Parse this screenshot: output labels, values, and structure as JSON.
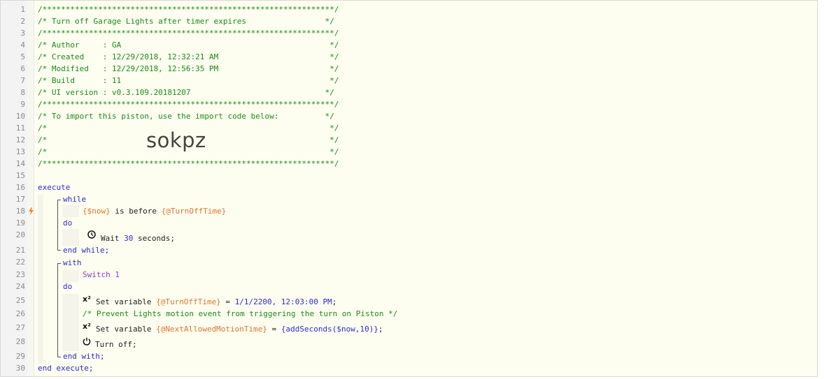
{
  "header": {
    "border_line": "/***************************************************************/",
    "title_line": "/* Turn off Garage Lights after timer expires                 */",
    "author_line": "/* Author     : GA                                             */",
    "created_line": "/* Created    : 12/29/2018, 12:32:21 AM                        */",
    "modified_line": "/* Modified   : 12/29/2018, 12:56:35 PM                        */",
    "build_line": "/* Build      : 11                                             */",
    "ui_version_line": "/* UI version : v0.3.109.20181207                             */",
    "import_line": "/* To import this piston, use the import code below:          */",
    "blank_line": "/*                                                             */",
    "import_code": "sokpz"
  },
  "lines": [
    "1",
    "2",
    "3",
    "4",
    "5",
    "6",
    "7",
    "8",
    "9",
    "10",
    "11",
    "12",
    "13",
    "14",
    "15",
    "16",
    "17",
    "18",
    "19",
    "20",
    "21",
    "22",
    "23",
    "24",
    "25",
    "26",
    "27",
    "28",
    "29",
    "30"
  ],
  "code": {
    "execute": "execute",
    "while": "while",
    "cond_var": "{$now}",
    "cond_op": " is before ",
    "cond_target": "{@TurnOffTime}",
    "do1": "do",
    "wait_text": "Wait ",
    "wait_num": "30",
    "wait_unit": " seconds;",
    "end_while": "end while;",
    "with": "with",
    "device": "Switch 1",
    "do2": "do",
    "set1_text": "Set variable ",
    "set1_var": "{@TurnOffTime}",
    "set1_eq": " = ",
    "set1_val": "1/1/2200, 12:03:00 PM",
    "set1_end": ";",
    "comment": "/* Prevent Lights motion event from triggering the turn on Piston */",
    "set2_text": "Set variable ",
    "set2_var": "{@NextAllowedMotionTime}",
    "set2_eq": " = ",
    "set2_val": "{addSeconds($now,10)}",
    "set2_end": ";",
    "turn_off": "Turn off;",
    "end_with": "end with;",
    "end_execute": "end execute;",
    "sup": "x²"
  },
  "colors": {
    "comment": "#1a8a1a",
    "keyword": "#2a2ad8",
    "variable": "#e0752b",
    "device": "#8e38c8"
  },
  "icons": [
    "clock-icon",
    "power-icon",
    "lightning-icon",
    "variable-icon"
  ]
}
